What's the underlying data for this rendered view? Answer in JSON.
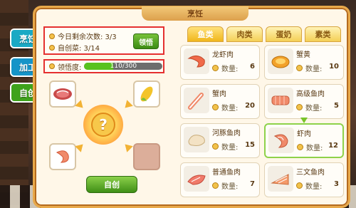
{
  "window": {
    "title": "烹饪"
  },
  "side_tabs": [
    {
      "label": "烹饪"
    },
    {
      "label": "加工"
    },
    {
      "label": "自创"
    }
  ],
  "info": {
    "remaining_label": "今日剩余次数: 3/3",
    "created_label": "自创菜: 3/14",
    "lingwu_button": "领悟"
  },
  "progress": {
    "label": "领悟度:",
    "text": "110/300",
    "value": 110,
    "max": 300
  },
  "recipe_slots": [
    {
      "item": "meat",
      "icon": "meat-icon"
    },
    {
      "item": "corn",
      "icon": "corn-icon"
    },
    {
      "item": "shrimp",
      "icon": "shrimp-icon"
    },
    {
      "item": "empty",
      "icon": ""
    }
  ],
  "create_button": "自创",
  "categories": [
    {
      "label": "鱼类",
      "active": true
    },
    {
      "label": "肉类",
      "active": false
    },
    {
      "label": "蛋奶",
      "active": false
    },
    {
      "label": "素类",
      "active": false
    }
  ],
  "qty_label": "数量:",
  "items": [
    {
      "name": "龙虾肉",
      "qty": "6",
      "icon": "lobster-meat-icon",
      "selected": false
    },
    {
      "name": "蟹黄",
      "qty": "10",
      "icon": "crab-roe-icon",
      "selected": false
    },
    {
      "name": "蟹肉",
      "qty": "20",
      "icon": "crab-meat-icon",
      "selected": false
    },
    {
      "name": "高级鱼肉",
      "qty": "5",
      "icon": "premium-fish-icon",
      "selected": false
    },
    {
      "name": "河豚鱼肉",
      "qty": "15",
      "icon": "pufferfish-icon",
      "selected": false
    },
    {
      "name": "虾肉",
      "qty": "12",
      "icon": "shrimp-meat-icon",
      "selected": true
    },
    {
      "name": "普通鱼肉",
      "qty": "7",
      "icon": "fish-meat-icon",
      "selected": false
    },
    {
      "name": "三文鱼肉",
      "qty": "3",
      "icon": "salmon-icon",
      "selected": false
    }
  ],
  "colors": {
    "accent": "#e8a94a",
    "highlight_border": "#e53030",
    "active_tab": "#f0b61c",
    "progress_fill": "#58c21e"
  }
}
